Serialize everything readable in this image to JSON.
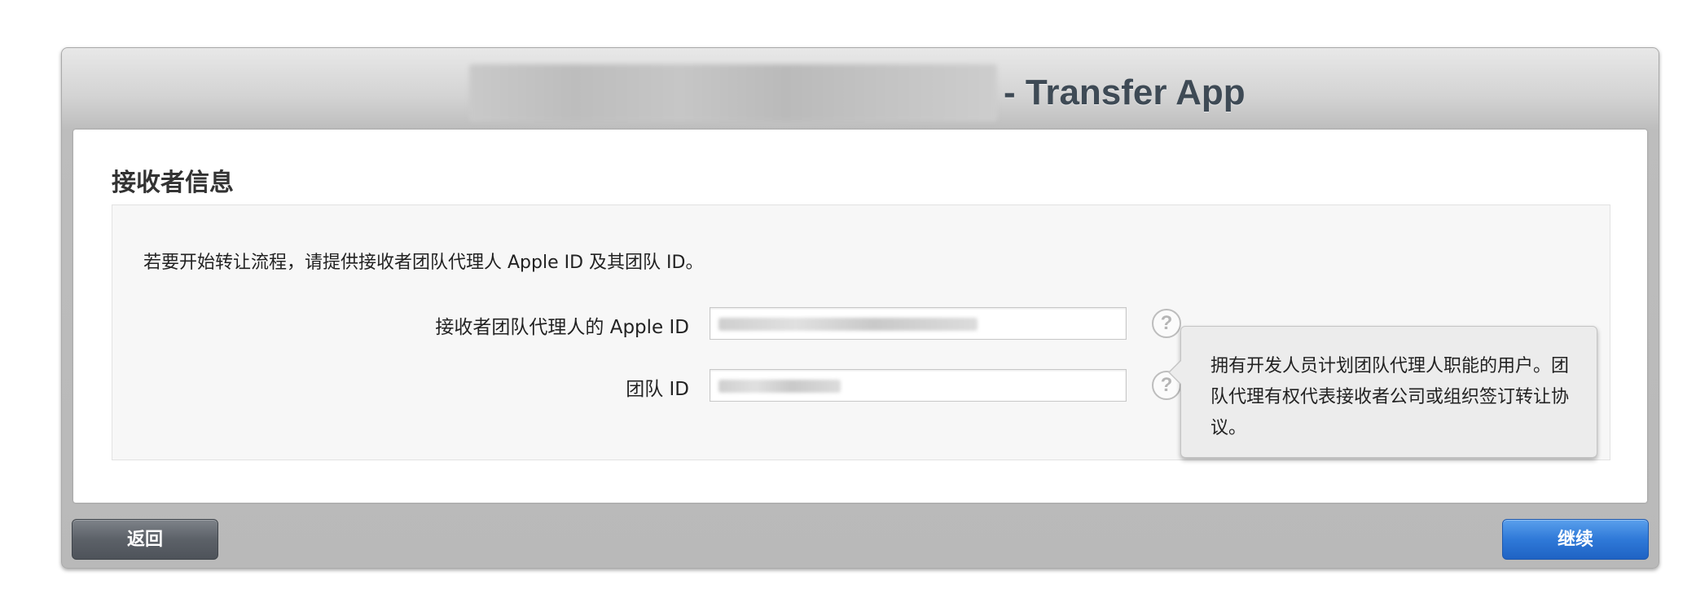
{
  "dialog": {
    "title_suffix": "- Transfer App"
  },
  "section": {
    "heading": "接收者信息",
    "intro": "若要开始转让流程，请提供接收者团队代理人 Apple ID 及其团队 ID。"
  },
  "form": {
    "apple_id_label": "接收者团队代理人的 Apple ID",
    "team_id_label": "团队 ID",
    "help_glyph": "?"
  },
  "tooltip": {
    "text": "拥有开发人员计划团队代理人职能的用户。团队代理有权代表接收者公司或组织签订转让协议。"
  },
  "buttons": {
    "back_label": "返回",
    "continue_label": "继续"
  },
  "colors": {
    "title_text": "#3e4a55",
    "primary_button": "#2f79d8",
    "secondary_button": "#5c6168"
  },
  "icons": {
    "help": "help-circle-icon"
  }
}
